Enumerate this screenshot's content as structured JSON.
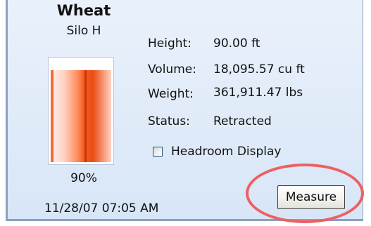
{
  "silo": {
    "product": "Wheat",
    "name": "Silo H",
    "fill_fraction": 0.9,
    "fill_percent_label": "90%",
    "timestamp": "11/28/07 07:05 AM"
  },
  "details": {
    "height_label": "Height:",
    "height_value": "90.00 ft",
    "volume_label": "Volume:",
    "volume_value": "18,095.57 cu ft",
    "weight_label": "Weight:",
    "weight_value": "361,911.47 lbs",
    "status_label": "Status:",
    "status_value": "Retracted"
  },
  "headroom": {
    "label": "Headroom Display",
    "checked": false
  },
  "actions": {
    "measure_label": "Measure"
  },
  "colors": {
    "fill_accent": "#ea4d14",
    "panel_background": "#e2ecf9",
    "highlight": "#ee5f63"
  }
}
